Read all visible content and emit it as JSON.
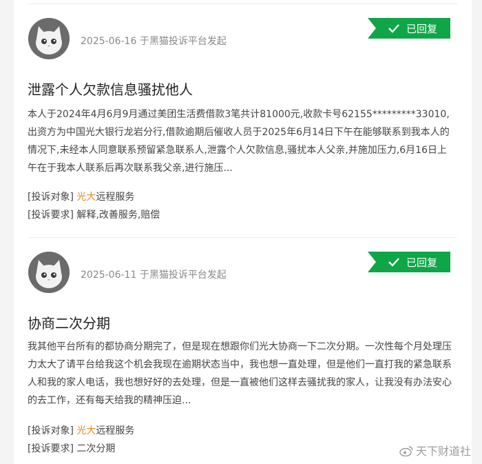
{
  "complaints": [
    {
      "date": "2025-06-16",
      "source": "于黑猫投诉平台发起",
      "status": "已回复",
      "title": "泄露个人欠款信息骚扰他人",
      "body": "本人于2024年4月6月9月通过美团生活费借款3笔共计81000元,收款卡号62155*********33010,出资方为中国光大银行龙岩分行,借款逾期后催收人员于2025年6月14日下午在能够联系到我本人的情况下,未经本人同意联系预留紧急联系人,泄露个人欠款信息,骚扰本人父亲,并施加压力,6月16日上午在于我本人联系后再次联系我父亲,进行施压...",
      "target_label": "[投诉对象]",
      "target_highlight": "光大",
      "target_rest": "远程服务",
      "request_label": "[投诉要求]",
      "request_value": "解释,改善服务,赔偿"
    },
    {
      "date": "2025-06-11",
      "source": "于黑猫投诉平台发起",
      "status": "已回复",
      "title": "协商二次分期",
      "body": "我其他平台所有的都协商分期完了，但是现在想跟你们光大协商一下二次分期。一次性每个月处理压力太大了请平台给我这个机会我现在逾期状态当中，我也想一直处理，但是他们一直打我的紧急联系人和我的家人电话，我也想好好的去处理，但是一直被他们这样去骚扰我的家人，让我没有办法安心的去工作，还有每天给我的精神压迫...",
      "target_label": "[投诉对象]",
      "target_highlight": "光大",
      "target_rest": "远程服务",
      "request_label": "[投诉要求]",
      "request_value": "二次分期"
    }
  ],
  "watermark": "天下财道社",
  "colors": {
    "badge_green": "#0fa648",
    "highlight_orange": "#e28d1c"
  },
  "icons": {
    "avatar": "cat-avatar-icon",
    "badge": "check-icon",
    "watermark": "weibo-icon"
  }
}
